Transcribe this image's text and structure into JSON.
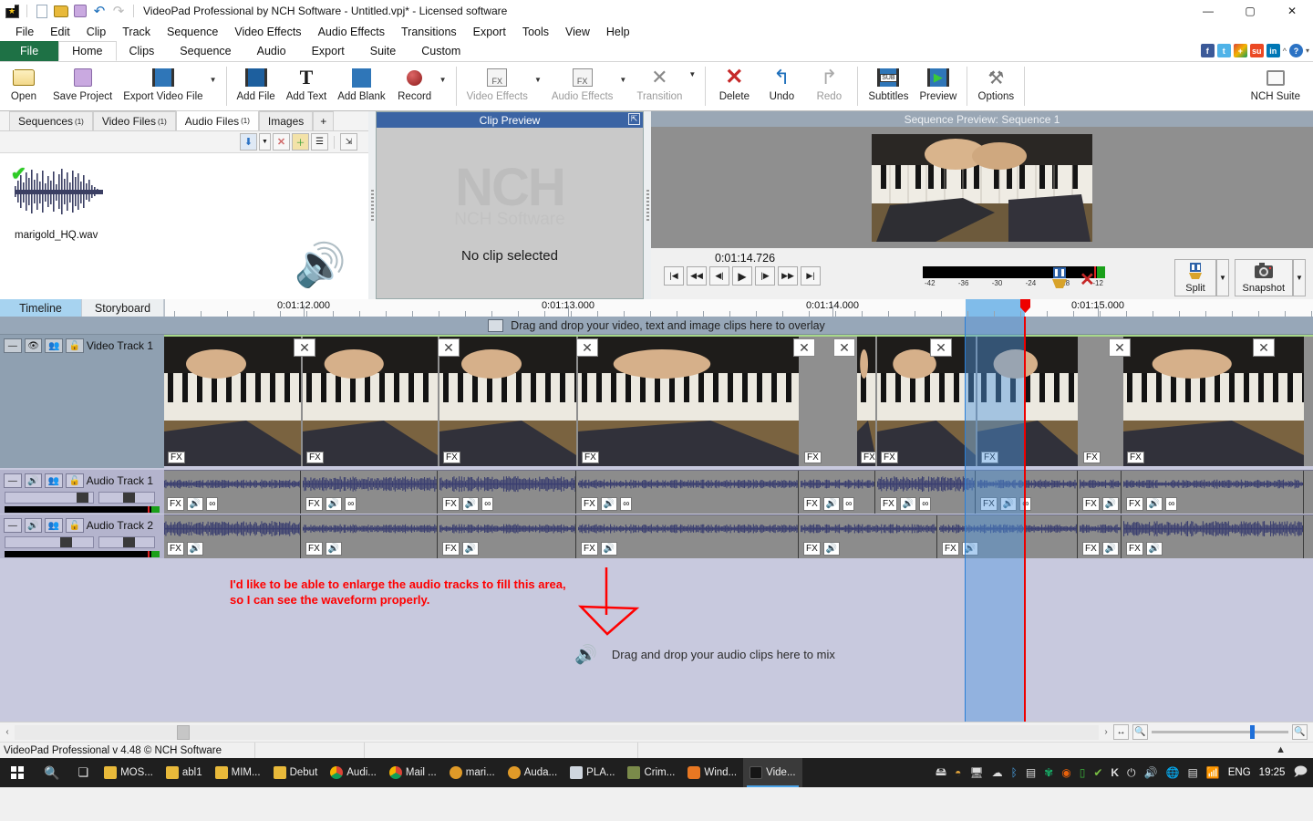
{
  "window": {
    "title": "VideoPad Professional by NCH Software - Untitled.vpj* - Licensed software",
    "minimize": "—",
    "maximize": "▢",
    "close": "✕"
  },
  "quick_access": [
    "new-icon",
    "open-folder-icon",
    "save-icon",
    "undo-icon",
    "redo-icon"
  ],
  "menubar": [
    "File",
    "Edit",
    "Clip",
    "Track",
    "Sequence",
    "Video Effects",
    "Audio Effects",
    "Transitions",
    "Export",
    "Tools",
    "View",
    "Help"
  ],
  "ribbon_tabs": [
    {
      "label": "File",
      "style": "file"
    },
    {
      "label": "Home",
      "style": "active"
    },
    {
      "label": "Clips",
      "style": "normal"
    },
    {
      "label": "Sequence",
      "style": "normal"
    },
    {
      "label": "Audio",
      "style": "normal"
    },
    {
      "label": "Export",
      "style": "normal"
    },
    {
      "label": "Suite",
      "style": "normal"
    },
    {
      "label": "Custom",
      "style": "normal"
    }
  ],
  "social_icons": [
    "facebook-icon",
    "twitter-icon",
    "google-plus-icon",
    "stumbleupon-icon",
    "linkedin-icon",
    "chevron-up-icon",
    "help-icon",
    "chevron-down-icon"
  ],
  "ribbon": {
    "groups": [
      {
        "buttons": [
          {
            "label": "Open",
            "icon": "open-folder-icon",
            "enabled": true
          },
          {
            "label": "Save Project",
            "icon": "save-floppy-icon",
            "enabled": true
          },
          {
            "label": "Export Video File",
            "icon": "export-film-icon",
            "enabled": true,
            "caret": true
          }
        ]
      },
      {
        "buttons": [
          {
            "label": "Add File",
            "icon": "add-file-icon",
            "enabled": true
          },
          {
            "label": "Add Text",
            "icon": "add-text-icon",
            "enabled": true
          },
          {
            "label": "Add Blank",
            "icon": "add-blank-icon",
            "enabled": true
          },
          {
            "label": "Record",
            "icon": "record-icon",
            "enabled": true,
            "caret": true
          }
        ]
      },
      {
        "buttons": [
          {
            "label": "Video Effects",
            "icon": "video-fx-icon",
            "enabled": false,
            "caret": true
          },
          {
            "label": "Audio Effects",
            "icon": "audio-fx-icon",
            "enabled": false,
            "caret": true
          },
          {
            "label": "Transition",
            "icon": "transition-icon",
            "enabled": false,
            "caret": true
          }
        ]
      },
      {
        "buttons": [
          {
            "label": "Delete",
            "icon": "delete-x-icon",
            "enabled": true
          },
          {
            "label": "Undo",
            "icon": "undo-arrow-icon",
            "enabled": true
          },
          {
            "label": "Redo",
            "icon": "redo-arrow-icon",
            "enabled": false
          }
        ]
      },
      {
        "buttons": [
          {
            "label": "Subtitles",
            "icon": "subtitles-icon",
            "enabled": true
          },
          {
            "label": "Preview",
            "icon": "preview-play-icon",
            "enabled": true
          }
        ]
      },
      {
        "buttons": [
          {
            "label": "Options",
            "icon": "options-tools-icon",
            "enabled": true
          }
        ]
      }
    ],
    "nch_suite": {
      "label": "NCH Suite",
      "icon": "suitcase-icon"
    }
  },
  "bin": {
    "tabs": [
      {
        "label": "Sequences",
        "count": "(1)",
        "active": false
      },
      {
        "label": "Video Files",
        "count": "(1)",
        "active": false
      },
      {
        "label": "Audio Files",
        "count": "(1)",
        "active": true
      },
      {
        "label": "Images",
        "count": "",
        "active": false
      },
      {
        "label": "+",
        "count": "",
        "active": false
      }
    ],
    "toolbar_icons": [
      "add-down-icon",
      "add-dropdown-caret",
      "remove-x-icon",
      "new-folder-icon",
      "list-view-icon",
      "detach-icon"
    ],
    "items": [
      {
        "name": "marigold_HQ.wav",
        "icon": "audio-waveform-thumb",
        "checked": true
      }
    ],
    "speaker_icon": "speaker-icon"
  },
  "clip_preview": {
    "title": "Clip Preview",
    "watermark_top": "NCH",
    "watermark_bottom": "NCH Software",
    "empty_message": "No clip selected",
    "popout_icon": "popout-icon"
  },
  "sequence_preview": {
    "title": "Sequence Preview: Sequence 1",
    "timecode": "0:01:14.726",
    "transport_buttons": [
      "skip-start-icon",
      "prev-clip-icon",
      "step-back-icon",
      "play-icon",
      "step-forward-icon",
      "next-clip-icon",
      "skip-end-icon"
    ],
    "meter_scale": [
      "-42",
      "-36",
      "-30",
      "-24",
      "-18",
      "-12"
    ],
    "mute_icon": "mute-x-icon",
    "clamp_icon": "clamp-icon",
    "split_label": "Split",
    "split_icon": "split-icon",
    "snapshot_label": "Snapshot",
    "snapshot_icon": "camera-icon"
  },
  "timeline": {
    "tabs": [
      {
        "label": "Timeline",
        "active": true
      },
      {
        "label": "Storyboard",
        "active": false
      }
    ],
    "ruler_labels": [
      "0:01:12.000",
      "0:01:13.000",
      "0:01:14.000",
      "0:01:15.000"
    ],
    "ruler_label_positions": [
      332,
      622,
      912,
      1203
    ],
    "overlay_hint": "Drag and drop your video, text and image clips here to overlay",
    "overlay_icon": "image-placeholder-icon",
    "video_track": {
      "name": "Video Track 1",
      "controls": [
        "collapse-icon",
        "eye-icon",
        "group-icon",
        "lock-icon"
      ],
      "fx_badge": "FX",
      "transition_badge": "✕"
    },
    "audio_tracks": [
      {
        "name": "Audio Track 1",
        "controls": [
          "collapse-icon",
          "speaker-icon",
          "group-icon",
          "lock-icon"
        ],
        "badges": [
          "FX",
          "speaker-icon",
          "link-icon"
        ]
      },
      {
        "name": "Audio Track 2",
        "controls": [
          "collapse-icon",
          "speaker-icon",
          "group-icon",
          "lock-icon"
        ],
        "badges": [
          "FX",
          "speaker-icon"
        ]
      }
    ],
    "audio_drop_hint": "Drag and drop your audio clips here to mix",
    "audio_drop_icon": "speaker-icon",
    "annotation": {
      "line1": "I'd like to be able to enlarge the audio tracks to fill this area,",
      "line2": "so I can see the waveform properly.",
      "color": "#ff0000"
    },
    "zoom_icons": [
      "fit-width-icon",
      "zoom-out-icon",
      "zoom-in-icon"
    ],
    "scroll_arrows": [
      "scroll-left-icon",
      "scroll-right-icon"
    ]
  },
  "status_bar": {
    "text": "VideoPad Professional v 4.48 © NCH Software",
    "up_arrow": "▲"
  },
  "taskbar": {
    "start_icon": "windows-start-icon",
    "search_icon": "search-icon",
    "taskview_icon": "task-view-icon",
    "items": [
      {
        "label": "MOS...",
        "icon": "folder-icon",
        "active": false,
        "running": true
      },
      {
        "label": "abl1",
        "icon": "folder-icon",
        "active": false,
        "running": true
      },
      {
        "label": "MIM...",
        "icon": "folder-icon",
        "active": false,
        "running": true
      },
      {
        "label": "Debut",
        "icon": "folder-icon",
        "active": false,
        "running": true
      },
      {
        "label": "Audi...",
        "icon": "chrome-icon",
        "active": false,
        "running": true
      },
      {
        "label": "Mail ...",
        "icon": "chrome-icon",
        "active": false,
        "running": true
      },
      {
        "label": "mari...",
        "icon": "audacity-icon",
        "active": false,
        "running": true
      },
      {
        "label": "Auda...",
        "icon": "audacity-icon",
        "active": false,
        "running": true
      },
      {
        "label": "PLA...",
        "icon": "notepad-icon",
        "active": false,
        "running": true
      },
      {
        "label": "Crim...",
        "icon": "crimson-icon",
        "active": false,
        "running": true
      },
      {
        "label": "Wind...",
        "icon": "media-player-icon",
        "active": false,
        "running": true
      },
      {
        "label": "Vide...",
        "icon": "videopad-icon",
        "active": true,
        "running": true
      }
    ],
    "tray_icons": [
      "usb-icon",
      "ellipse-icon",
      "display-icon",
      "onedrive-icon",
      "bluetooth-icon",
      "battery-icon",
      "kaspersky-shield-icon",
      "opera-icon",
      "green-doc-icon",
      "green-check-icon",
      "k-icon",
      "power-icon",
      "volume-icon",
      "globe-icon",
      "network-device-icon",
      "wifi-icon"
    ],
    "language": "ENG",
    "clock": "19:25",
    "notification_icon": "notifications-icon"
  }
}
